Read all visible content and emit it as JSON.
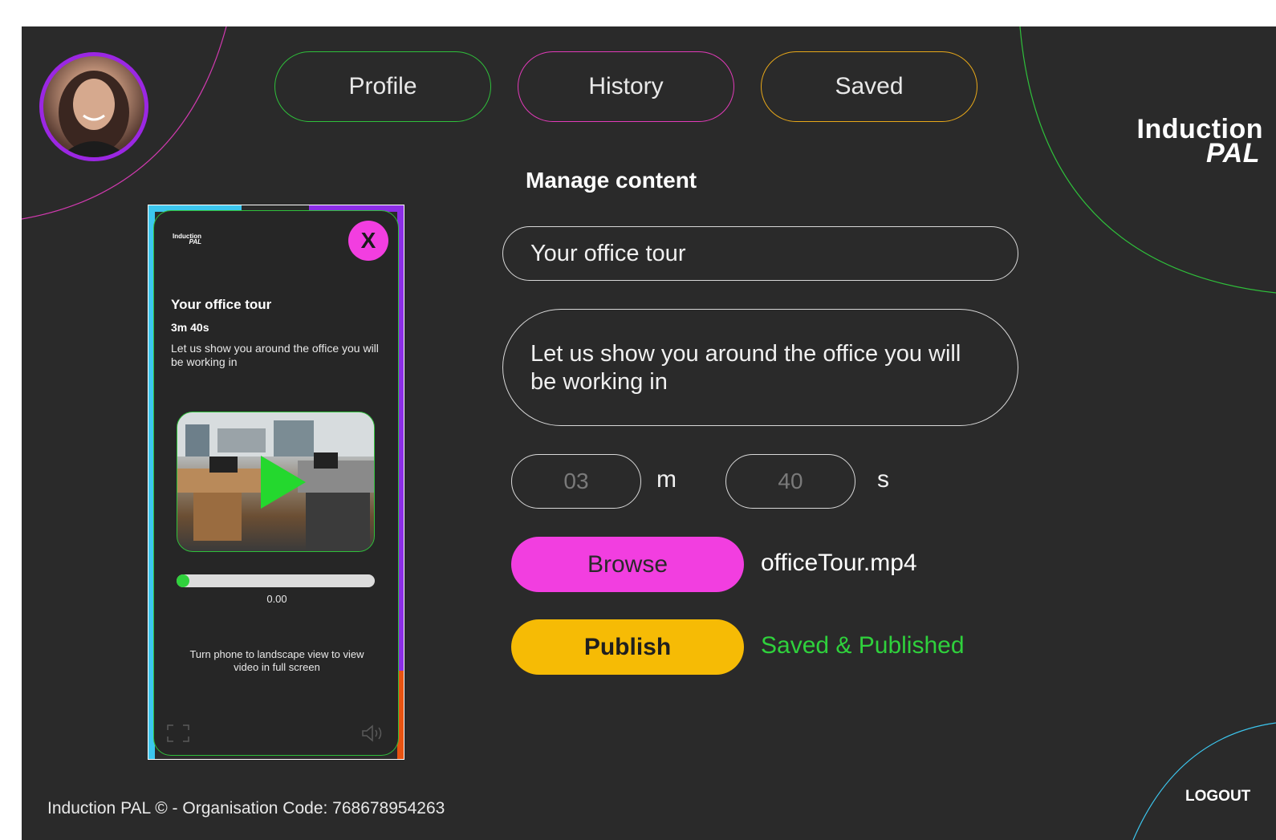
{
  "nav": {
    "profile_label": "Profile",
    "history_label": "History",
    "saved_label": "Saved"
  },
  "brand": {
    "line1": "Induction",
    "line2": "PAL"
  },
  "manage": {
    "section_title": "Manage content",
    "title_value": "Your office tour",
    "description_value": "Let us show you around the office you will be working in",
    "minutes_value": "03",
    "minutes_unit": "m",
    "seconds_value": "40",
    "seconds_unit": "s",
    "browse_label": "Browse",
    "file_name": "officeTour.mp4",
    "publish_label": "Publish",
    "status_text": "Saved & Published"
  },
  "preview": {
    "logo_line1": "Induction",
    "logo_line2": "PAL",
    "close_label": "X",
    "title": "Your office tour",
    "duration": "3m 40s",
    "description": "Let us show you around the office you will be working in",
    "progress_fraction": 0.04,
    "time_label": "0.00",
    "hint": "Turn phone to landscape view to view video in full screen"
  },
  "footer": {
    "text": "Induction PAL © - Organisation Code: 768678954263"
  },
  "logout_label": "LOGOUT",
  "colors": {
    "background": "#2a2a2a",
    "green": "#2fc03b",
    "magenta": "#f23ee0",
    "yellow": "#f6bb05",
    "purple": "#9b27e3",
    "cyan": "#3cc6ee",
    "orange": "#e85311"
  },
  "icons": {
    "close": "close-icon",
    "play": "play-icon",
    "fullscreen": "fullscreen-icon",
    "volume": "volume-icon"
  }
}
